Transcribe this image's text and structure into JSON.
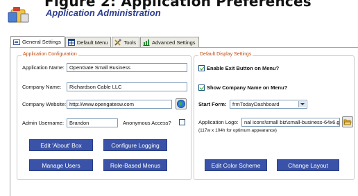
{
  "figure": {
    "title": "Figure 2: Application Preferences"
  },
  "header": {
    "title": "Application Administration"
  },
  "tabs": [
    {
      "label": "General Settings",
      "icon": "settings-form-icon",
      "active": true
    },
    {
      "label": "Default Menu",
      "icon": "menu-grid-icon",
      "active": false
    },
    {
      "label": "Tools",
      "icon": "tools-icon",
      "active": false
    },
    {
      "label": "Advanced Settings",
      "icon": "chart-icon",
      "active": false
    }
  ],
  "app_config": {
    "group_label": "Application Configuration",
    "app_name_label": "Application Name:",
    "app_name_value": "OpenGate Small Business",
    "company_name_label": "Company Name:",
    "company_name_value": "Richardson Cable LLC",
    "company_website_label": "Company Website:",
    "company_website_value": "http://www.opengatesw.com",
    "admin_username_label": "Admin Username:",
    "admin_username_value": "Brandon",
    "anonymous_access_label": "Anonymous Access?",
    "buttons": {
      "edit_about": "Edit 'About' Box",
      "configure_logging": "Configure Logging",
      "manage_users": "Manage Users",
      "role_based_menus": "Role-Based Menus"
    }
  },
  "display_settings": {
    "group_label": "Default Display Settings",
    "enable_exit_label": "Enable Exit Button on Menu?",
    "show_company_label": "Show Company Name on Menu?",
    "start_form_label": "Start Form:",
    "start_form_value": "frmTodayDashboard",
    "app_logo_label": "Application Logo:",
    "app_logo_value": "nal icons\\small biz\\small-business-64x6.gif",
    "app_logo_hint": "(117w x 104h for optimum appearance)",
    "buttons": {
      "edit_color_scheme": "Edit Color Scheme",
      "change_layout": "Change Layout"
    }
  },
  "colors": {
    "accent_button": "#3a53a8",
    "group_label": "#c04a0a",
    "title": "#2c3d8f"
  }
}
